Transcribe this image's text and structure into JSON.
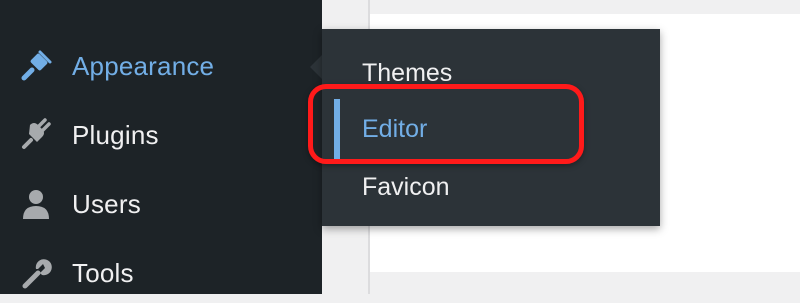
{
  "sidebar": {
    "items": [
      {
        "label": "Appearance",
        "icon": "paintbrush-icon",
        "active": true
      },
      {
        "label": "Plugins",
        "icon": "plug-icon",
        "active": false
      },
      {
        "label": "Users",
        "icon": "user-icon",
        "active": false
      },
      {
        "label": "Tools",
        "icon": "wrench-icon",
        "active": false
      }
    ]
  },
  "submenu": {
    "items": [
      {
        "label": "Themes",
        "current": false
      },
      {
        "label": "Editor",
        "current": true
      },
      {
        "label": "Favicon",
        "current": false
      }
    ]
  },
  "colors": {
    "sidebar_bg": "#1d2327",
    "flyout_bg": "#2c3338",
    "accent": "#72aee6",
    "text": "#f0f0f1",
    "icon": "#a7aaad",
    "highlight": "#ff1a1a"
  }
}
